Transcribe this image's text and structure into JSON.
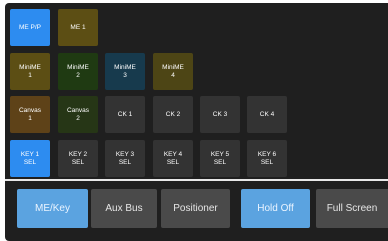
{
  "rows": [
    [
      {
        "l1": "ME P/P",
        "l2": "",
        "color": "#2d8cf0"
      },
      {
        "l1": "ME 1",
        "l2": "",
        "color": "#5c4e14"
      }
    ],
    [
      {
        "l1": "MiniME",
        "l2": "1",
        "color": "#5c4e14"
      },
      {
        "l1": "MiniME",
        "l2": "2",
        "color": "#1f3a12"
      },
      {
        "l1": "MiniME",
        "l2": "3",
        "color": "#173a4d"
      },
      {
        "l1": "MiniME",
        "l2": "4",
        "color": "#4d4515"
      }
    ],
    [
      {
        "l1": "Canvas",
        "l2": "1",
        "color": "#5e4218"
      },
      {
        "l1": "Canvas",
        "l2": "2",
        "color": "#263616"
      },
      {
        "l1": "CK 1",
        "l2": "",
        "color": "#333333"
      },
      {
        "l1": "CK 2",
        "l2": "",
        "color": "#333333"
      },
      {
        "l1": "CK 3",
        "l2": "",
        "color": "#333333"
      },
      {
        "l1": "CK 4",
        "l2": "",
        "color": "#333333"
      }
    ],
    [
      {
        "l1": "KEY 1",
        "l2": "SEL",
        "color": "#2d8cf0"
      },
      {
        "l1": "KEY 2",
        "l2": "SEL",
        "color": "#333333"
      },
      {
        "l1": "KEY 3",
        "l2": "SEL",
        "color": "#333333"
      },
      {
        "l1": "KEY 4",
        "l2": "SEL",
        "color": "#333333"
      },
      {
        "l1": "KEY 5",
        "l2": "SEL",
        "color": "#333333"
      },
      {
        "l1": "KEY 6",
        "l2": "SEL",
        "color": "#333333"
      }
    ]
  ],
  "tabs": [
    {
      "label": "ME/Key",
      "active": true
    },
    {
      "label": "Aux Bus",
      "active": false
    },
    {
      "label": "Positioner",
      "active": false
    },
    {
      "label": "Hold Off",
      "active": true
    },
    {
      "label": "Full Screen",
      "active": false
    }
  ],
  "colors": {
    "active_blue": "#2d8cf0",
    "tab_active": "#5ba3e0",
    "tab_inactive": "#4a4a4a",
    "panel_bg": "#1f1f1f"
  }
}
